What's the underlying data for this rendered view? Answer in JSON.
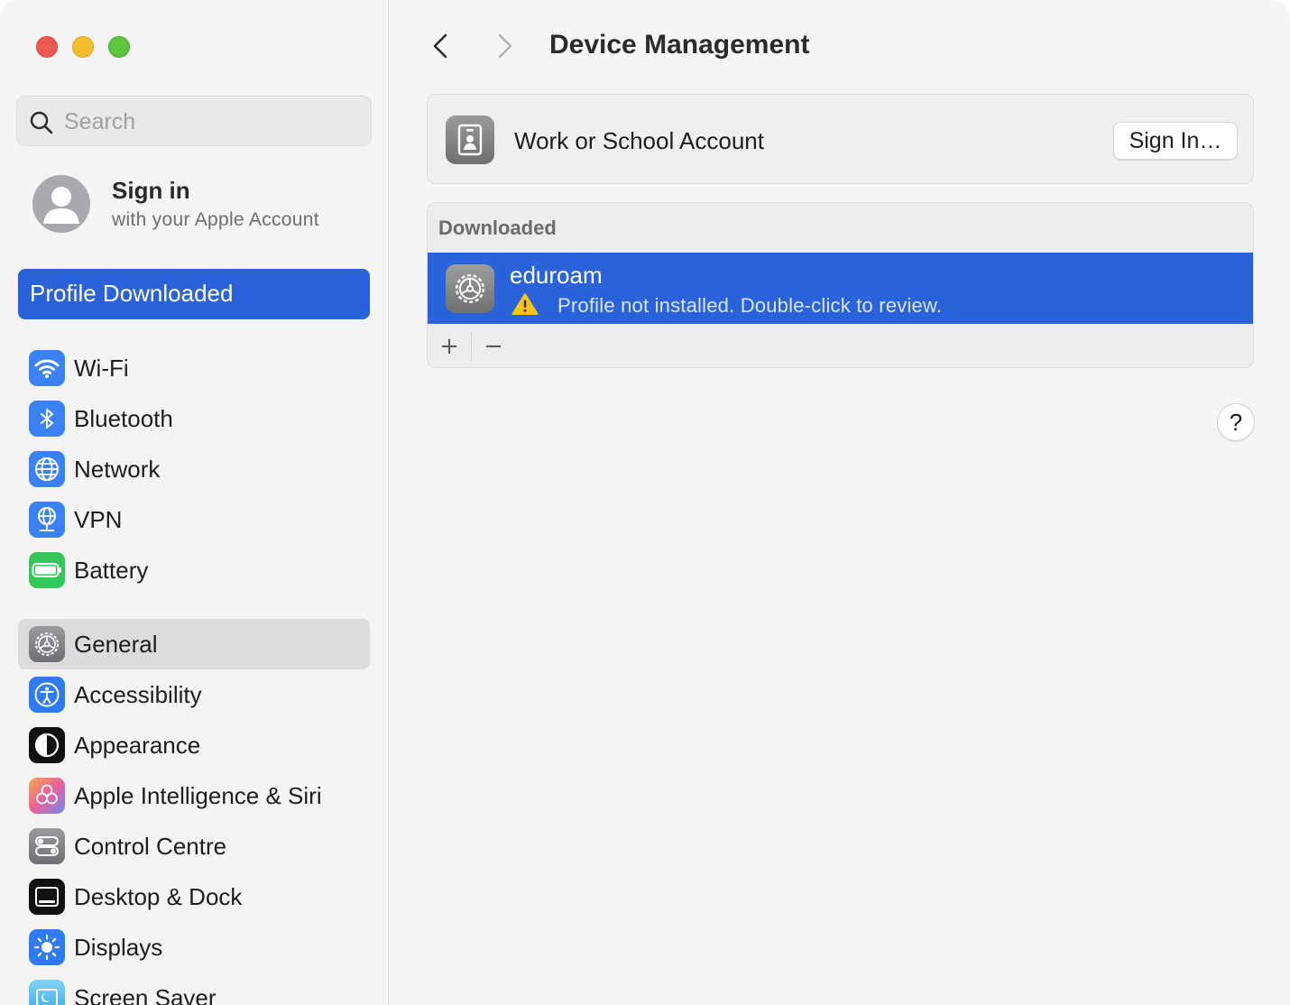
{
  "sidebar": {
    "search": {
      "placeholder": "Search",
      "value": ""
    },
    "account": {
      "title": "Sign in",
      "subtitle": "with your Apple Account"
    },
    "banner": "Profile Downloaded",
    "group1": [
      {
        "label": "Wi-Fi",
        "icon": "wifi-icon",
        "color": "#3b82f6"
      },
      {
        "label": "Bluetooth",
        "icon": "bluetooth-icon",
        "color": "#3b82f6"
      },
      {
        "label": "Network",
        "icon": "globe-icon",
        "color": "#3b82f6"
      },
      {
        "label": "VPN",
        "icon": "vpn-globe-icon",
        "color": "#3b82f6"
      },
      {
        "label": "Battery",
        "icon": "battery-icon",
        "color": "#34c759"
      }
    ],
    "group2": [
      {
        "label": "General",
        "icon": "gear-icon",
        "color": "#8e8e93",
        "selected": true
      },
      {
        "label": "Accessibility",
        "icon": "accessibility-icon",
        "color": "#2f7bf5"
      },
      {
        "label": "Appearance",
        "icon": "appearance-icon",
        "color": "#111111"
      },
      {
        "label": "Apple Intelligence & Siri",
        "icon": "siri-icon",
        "color": "#e46fa8"
      },
      {
        "label": "Control Centre",
        "icon": "toggles-icon",
        "color": "#8e8e93"
      },
      {
        "label": "Desktop & Dock",
        "icon": "dock-icon",
        "color": "#111111"
      },
      {
        "label": "Displays",
        "icon": "sun-icon",
        "color": "#2f7bf5"
      },
      {
        "label": "Screen Saver",
        "icon": "screensaver-icon",
        "color": "#5ac8fa"
      }
    ]
  },
  "main": {
    "title": "Device Management",
    "account_card": {
      "label": "Work or School Account",
      "button": "Sign In…"
    },
    "downloaded": {
      "header": "Downloaded",
      "profile": {
        "name": "eduroam",
        "status": "Profile not installed. Double-click to review."
      },
      "add": "+",
      "remove": "−"
    },
    "help": "?"
  },
  "colors": {
    "accent": "#2a63d9",
    "window_bg": "#f5f5f5",
    "warning": "#f5c518"
  }
}
